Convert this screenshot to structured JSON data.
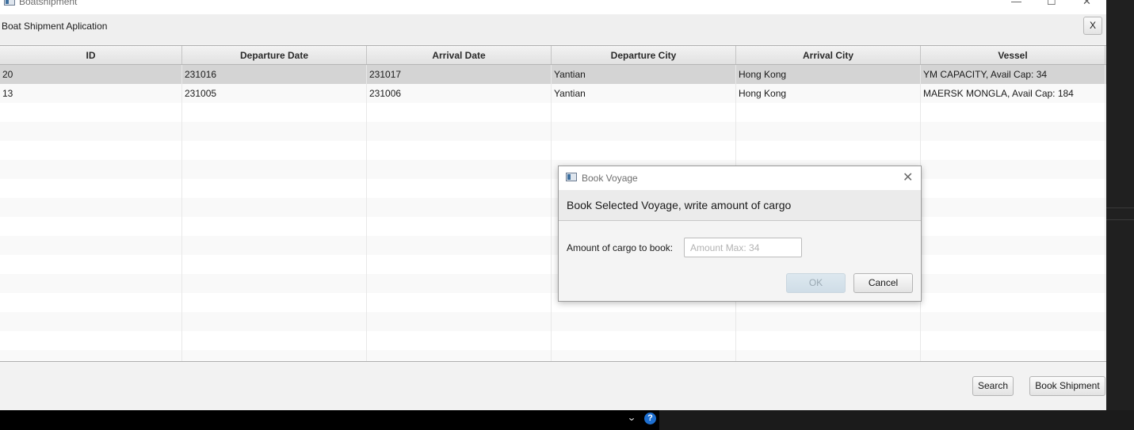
{
  "window": {
    "title": "Boatshipment",
    "controls": {
      "minimize": "—",
      "maximize": "☐",
      "close": "✕"
    }
  },
  "header": {
    "label": "Boat Shipment Aplication",
    "close_button": "X"
  },
  "table": {
    "columns": [
      "ID",
      "Departure Date",
      "Arrival Date",
      "Departure City",
      "Arrival City",
      "Vessel"
    ],
    "rows": [
      [
        "20",
        "231016",
        "231017",
        "Yantian",
        "Hong Kong",
        "YM CAPACITY, Avail Cap: 34"
      ],
      [
        "13",
        "231005",
        "231006",
        "Yantian",
        "Hong Kong",
        "MAERSK MONGLA, Avail Cap: 184"
      ]
    ],
    "selected_row": 0
  },
  "buttons": {
    "search": "Search",
    "book_shipment": "Book Shipment"
  },
  "dialog": {
    "title": "Book Voyage",
    "close": "✕",
    "header": "Book Selected Voyage, write amount of cargo",
    "field_label": "Amount of cargo to book:",
    "field_value": "",
    "field_placeholder": "Amount Max: 34",
    "ok": "OK",
    "cancel": "Cancel"
  },
  "taskbar": {
    "chevron": "⌄",
    "help": "?"
  },
  "colors": {
    "selected_row": "#d4d4d4",
    "ok_disabled_bg": "#cfdde7",
    "help_icon": "#1e6fd0"
  }
}
